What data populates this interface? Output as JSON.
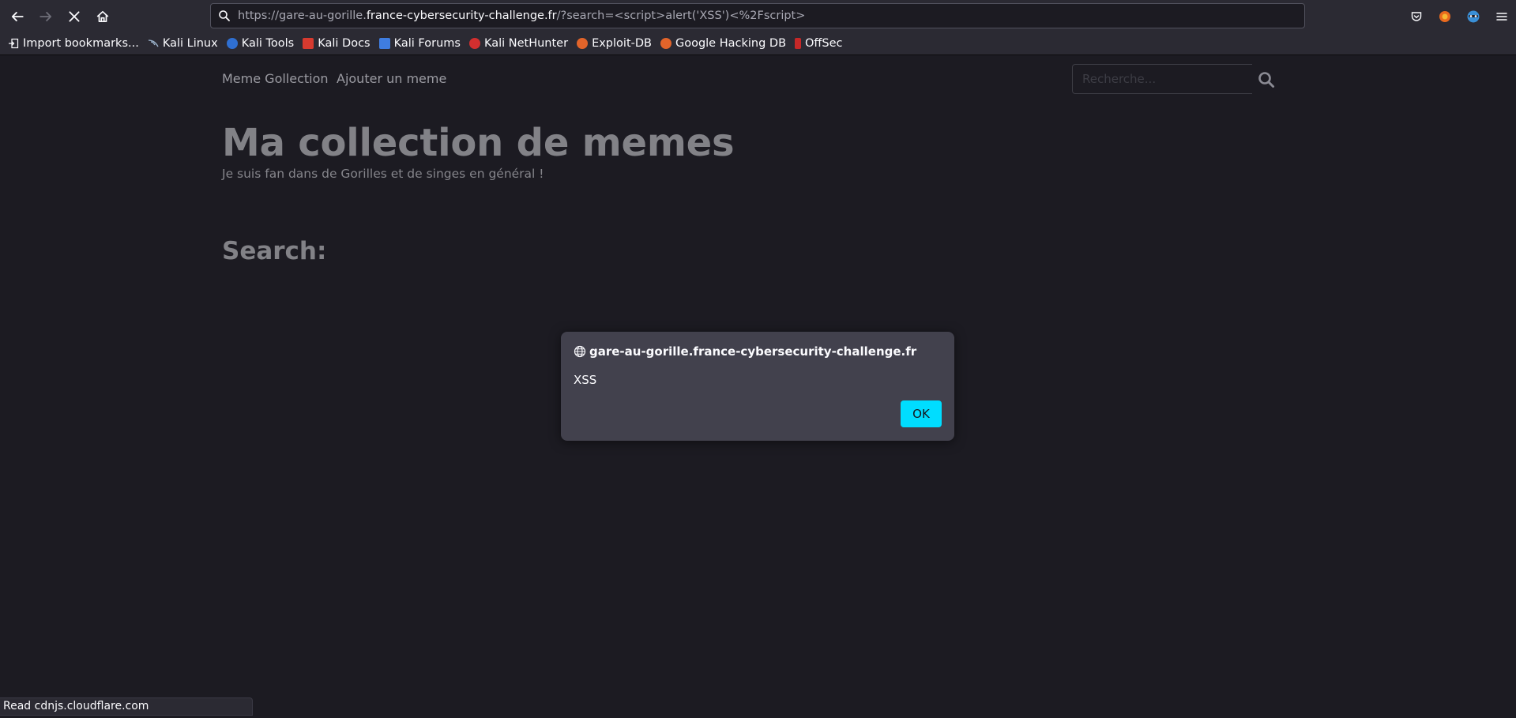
{
  "browser": {
    "url_prefix": "https://gare-au-gorille.",
    "url_domain": "france-cybersecurity-challenge.fr",
    "url_path": "/?search=<script>alert('XSS')<%2Fscript>",
    "icons": [
      "back-arrow-icon",
      "forward-arrow-icon",
      "stop-loading-icon",
      "home-icon",
      "search-icon",
      "pocket-icon",
      "extension-icon",
      "account-icon",
      "menu-icon"
    ],
    "bookmarks": [
      {
        "label": "Import bookmarks...",
        "color": "#fbfbfe"
      },
      {
        "label": "Kali Linux",
        "color": "#3b82c4"
      },
      {
        "label": "Kali Tools",
        "color": "#2f6fd1"
      },
      {
        "label": "Kali Docs",
        "color": "#d63a2f"
      },
      {
        "label": "Kali Forums",
        "color": "#3f7de0"
      },
      {
        "label": "Kali NetHunter",
        "color": "#d32f2f"
      },
      {
        "label": "Exploit-DB",
        "color": "#e2642a"
      },
      {
        "label": "Google Hacking DB",
        "color": "#e2642a"
      },
      {
        "label": "OffSec",
        "color": "#c62828"
      }
    ]
  },
  "site": {
    "nav": [
      "Meme Gollection",
      "Ajouter un meme"
    ],
    "search_placeholder": "Recherche...",
    "title": "Ma collection de memes",
    "subtitle": "Je suis fan dans de Gorilles et de singes en général !",
    "search_heading": "Search:"
  },
  "dialog": {
    "origin": "gare-au-gorille.france-cybersecurity-challenge.fr",
    "message": "XSS",
    "ok_label": "OK"
  },
  "status_text": "Read cdnjs.cloudflare.com"
}
